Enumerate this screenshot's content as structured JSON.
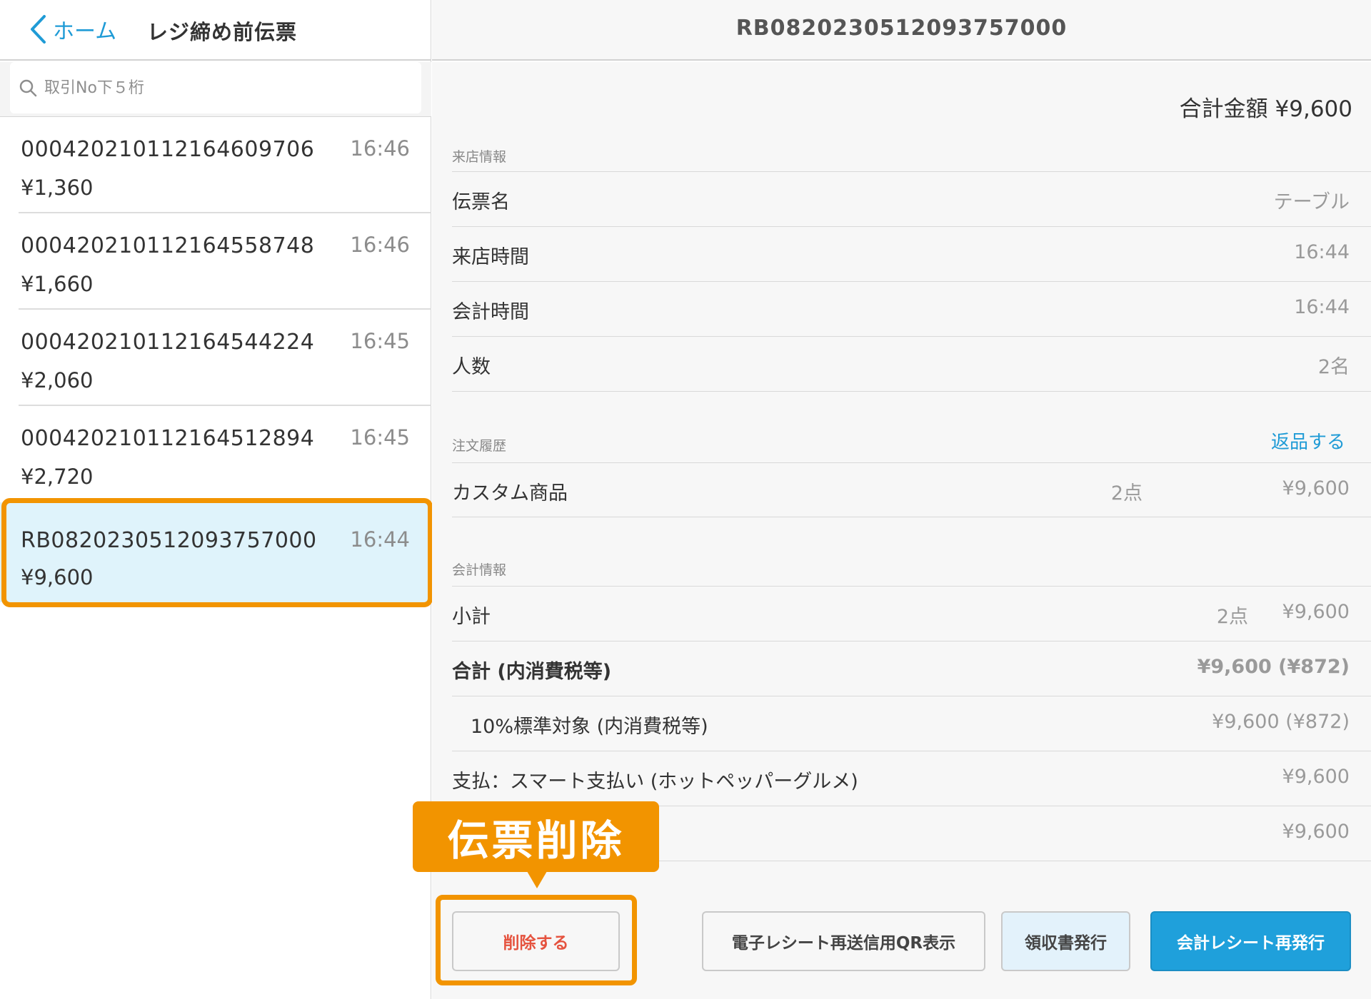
{
  "left_header": {
    "back_label": "ホーム",
    "title": "レジ締め前伝票"
  },
  "search": {
    "placeholder": "取引No下５桁"
  },
  "slips": [
    {
      "number": "00042021011216460​9706",
      "amount": "¥1,360",
      "time": "16:46"
    },
    {
      "number": "00042021011216455​8748",
      "amount": "¥1,660",
      "time": "16:46"
    },
    {
      "number": "00042021011216454​4224",
      "amount": "¥2,060",
      "time": "16:45"
    },
    {
      "number": "00042021011216451​2894",
      "amount": "¥2,720",
      "time": "16:45"
    },
    {
      "number": "RB0820230512093757000",
      "amount": "¥9,600",
      "time": "16:44"
    }
  ],
  "detail": {
    "title": "RB0820230512093757000",
    "total_amount": "合計金額 ¥9,600",
    "visit_section": {
      "label": "来店情報",
      "rows": [
        {
          "label": "伝票名",
          "value": "テーブル"
        },
        {
          "label": "来店時間",
          "value": "16:44"
        },
        {
          "label": "会計時間",
          "value": "16:44"
        },
        {
          "label": "人数",
          "value": "2名"
        }
      ]
    },
    "order_section": {
      "label": "注文履歴",
      "return_link": "返品する",
      "items": [
        {
          "label": "カスタム商品",
          "qty": "2点",
          "value": "¥9,600"
        }
      ]
    },
    "payment_section": {
      "label": "会計情報",
      "subtotal": {
        "label": "小計",
        "qty": "2点",
        "value": "¥9,600"
      },
      "total": {
        "label": "合計 (内消費税等)",
        "value": "¥9,600 (¥872)"
      },
      "tax": {
        "label": "10%標準対象 (内消費税等)",
        "value": "¥9,600 (¥872)"
      },
      "payment": {
        "label": "支払：スマート支払い (ホットペッパーグルメ)",
        "value": "¥9,600"
      },
      "extra": {
        "value": "¥9,600"
      }
    }
  },
  "buttons": {
    "delete": "削除する",
    "qr": "電子レシート再送信用QR表示",
    "receipt": "領収書発行",
    "reissue": "会計レシート再発行"
  },
  "callout": {
    "text": "伝票削除"
  },
  "colors": {
    "accent": "#1f9bd6",
    "highlight": "#f29400",
    "selected_bg": "#dff3fb",
    "delete_text": "#e5533f"
  }
}
